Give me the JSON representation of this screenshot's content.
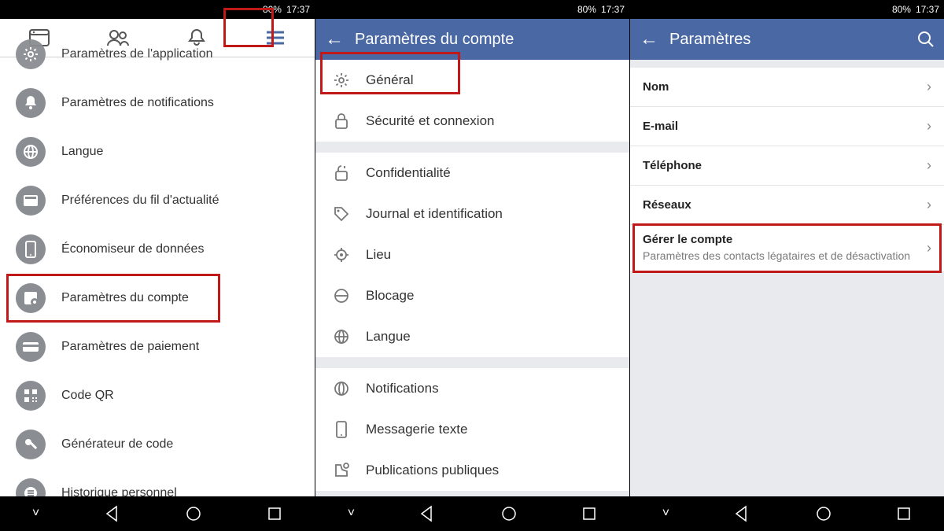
{
  "status": {
    "battery": "80%",
    "time": "17:37"
  },
  "pane1": {
    "menu": [
      {
        "name": "app-settings",
        "label": "Paramètres de l'application"
      },
      {
        "name": "notification-settings",
        "label": "Paramètres de notifications"
      },
      {
        "name": "language",
        "label": "Langue"
      },
      {
        "name": "news-feed-preferences",
        "label": "Préférences du fil d'actualité"
      },
      {
        "name": "data-saver",
        "label": "Économiseur de données"
      },
      {
        "name": "account-settings",
        "label": "Paramètres du compte",
        "highlight": true
      },
      {
        "name": "payment-settings",
        "label": "Paramètres de paiement"
      },
      {
        "name": "qr-code",
        "label": "Code QR"
      },
      {
        "name": "code-generator",
        "label": "Générateur de code"
      },
      {
        "name": "activity-log",
        "label": "Historique personnel"
      }
    ]
  },
  "pane2": {
    "title": "Paramètres du compte",
    "groups": [
      [
        {
          "name": "general",
          "label": "Général",
          "highlight": true
        },
        {
          "name": "security-login",
          "label": "Sécurité et connexion"
        }
      ],
      [
        {
          "name": "privacy",
          "label": "Confidentialité"
        },
        {
          "name": "timeline-tagging",
          "label": "Journal et identification"
        },
        {
          "name": "location",
          "label": "Lieu"
        },
        {
          "name": "blocking",
          "label": "Blocage"
        },
        {
          "name": "language",
          "label": "Langue"
        }
      ],
      [
        {
          "name": "notifications",
          "label": "Notifications"
        },
        {
          "name": "text-messaging",
          "label": "Messagerie texte"
        },
        {
          "name": "public-posts",
          "label": "Publications publiques"
        }
      ]
    ]
  },
  "pane3": {
    "title": "Paramètres",
    "rows": [
      {
        "name": "name",
        "label": "Nom"
      },
      {
        "name": "email",
        "label": "E-mail"
      },
      {
        "name": "phone",
        "label": "Téléphone"
      },
      {
        "name": "networks",
        "label": "Réseaux"
      },
      {
        "name": "manage-account",
        "label": "Gérer le compte",
        "sub": "Paramètres des contacts légataires et de désactivation",
        "highlight": true
      }
    ]
  }
}
